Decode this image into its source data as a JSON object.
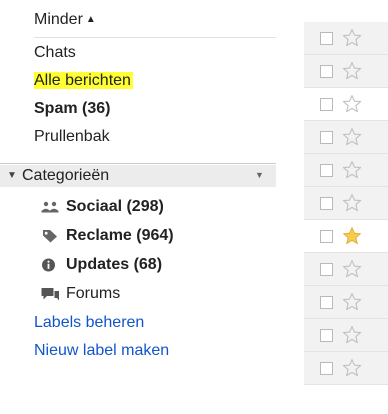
{
  "nav": {
    "toggle_label": "Minder",
    "toggle_caret": "▲",
    "items": [
      {
        "label": "Chats"
      },
      {
        "label": "Alle berichten"
      },
      {
        "label": "Spam (36)"
      },
      {
        "label": "Prullenbak"
      }
    ],
    "categories": {
      "label": "Categorieën",
      "arrow": "▼",
      "menu_glyph": "▼",
      "items": [
        {
          "label": "Sociaal (298)",
          "icon": "people-icon"
        },
        {
          "label": "Reclame (964)",
          "icon": "tag-icon"
        },
        {
          "label": "Updates (68)",
          "icon": "info-icon"
        },
        {
          "label": "Forums",
          "icon": "forum-icon"
        }
      ]
    },
    "links": [
      {
        "label": "Labels beheren"
      },
      {
        "label": "Nieuw label maken"
      }
    ]
  },
  "list": {
    "rows": [
      {
        "starred": false,
        "unread": false
      },
      {
        "starred": false,
        "unread": false
      },
      {
        "starred": false,
        "unread": true
      },
      {
        "starred": false,
        "unread": false
      },
      {
        "starred": false,
        "unread": false
      },
      {
        "starred": false,
        "unread": false
      },
      {
        "starred": true,
        "unread": true
      },
      {
        "starred": false,
        "unread": false
      },
      {
        "starred": false,
        "unread": false
      },
      {
        "starred": false,
        "unread": false
      },
      {
        "starred": false,
        "unread": false
      }
    ]
  },
  "colors": {
    "highlight": "#ffff33",
    "link": "#1155cc",
    "star_on": "#f7cb4d",
    "star_off": "#c0c0c0"
  }
}
